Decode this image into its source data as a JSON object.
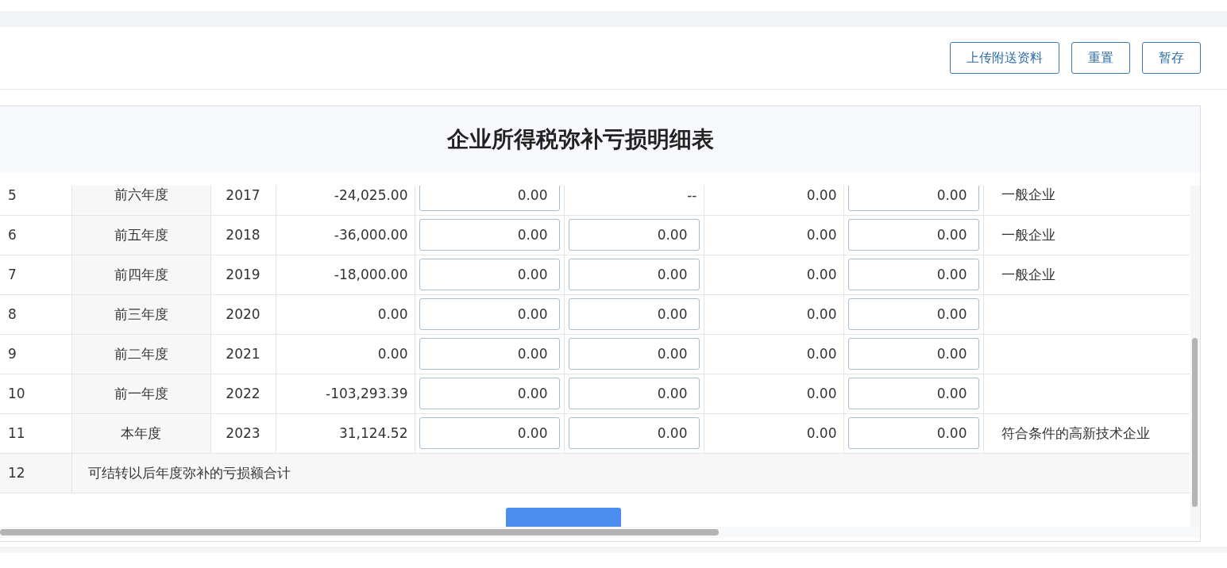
{
  "toolbar": {
    "buttons": [
      "上传附送资料",
      "重置",
      "暂存"
    ]
  },
  "form": {
    "title": "企业所得税弥补亏损明细表"
  },
  "table": {
    "rows": [
      {
        "kind": "year",
        "number": "5",
        "period": "前六年度",
        "year": "2017",
        "amount": "-24,025.00",
        "input_1": "0.00",
        "column_6": {
          "kind": "text",
          "value": "--"
        },
        "column_7": "0.00",
        "input_3": "0.00",
        "enterprise_type": "一般企业"
      },
      {
        "kind": "year",
        "number": "6",
        "period": "前五年度",
        "year": "2018",
        "amount": "-36,000.00",
        "input_1": "0.00",
        "column_6": {
          "kind": "input",
          "value": "0.00"
        },
        "column_7": "0.00",
        "input_3": "0.00",
        "enterprise_type": "一般企业"
      },
      {
        "kind": "year",
        "number": "7",
        "period": "前四年度",
        "year": "2019",
        "amount": "-18,000.00",
        "input_1": "0.00",
        "column_6": {
          "kind": "input",
          "value": "0.00"
        },
        "column_7": "0.00",
        "input_3": "0.00",
        "enterprise_type": "一般企业"
      },
      {
        "kind": "year",
        "number": "8",
        "period": "前三年度",
        "year": "2020",
        "amount": "0.00",
        "input_1": "0.00",
        "column_6": {
          "kind": "input",
          "value": "0.00"
        },
        "column_7": "0.00",
        "input_3": "0.00"
      },
      {
        "kind": "year",
        "number": "9",
        "period": "前二年度",
        "year": "2021",
        "amount": "0.00",
        "input_1": "0.00",
        "column_6": {
          "kind": "input",
          "value": "0.00"
        },
        "column_7": "0.00",
        "input_3": "0.00"
      },
      {
        "kind": "year",
        "number": "10",
        "period": "前一年度",
        "year": "2022",
        "amount": "-103,293.39",
        "input_1": "0.00",
        "column_6": {
          "kind": "input",
          "value": "0.00"
        },
        "column_7": "0.00",
        "input_3": "0.00"
      },
      {
        "kind": "year",
        "number": "11",
        "period": "本年度",
        "year": "2023",
        "amount": "31,124.52",
        "input_1": "0.00",
        "column_6": {
          "kind": "input",
          "value": "0.00"
        },
        "column_7": "0.00",
        "input_3": "0.00",
        "enterprise_type": "符合条件的高新技术企业"
      },
      {
        "kind": "total",
        "number": "12",
        "label": "可结转以后年度弥补的亏损额合计"
      }
    ]
  }
}
